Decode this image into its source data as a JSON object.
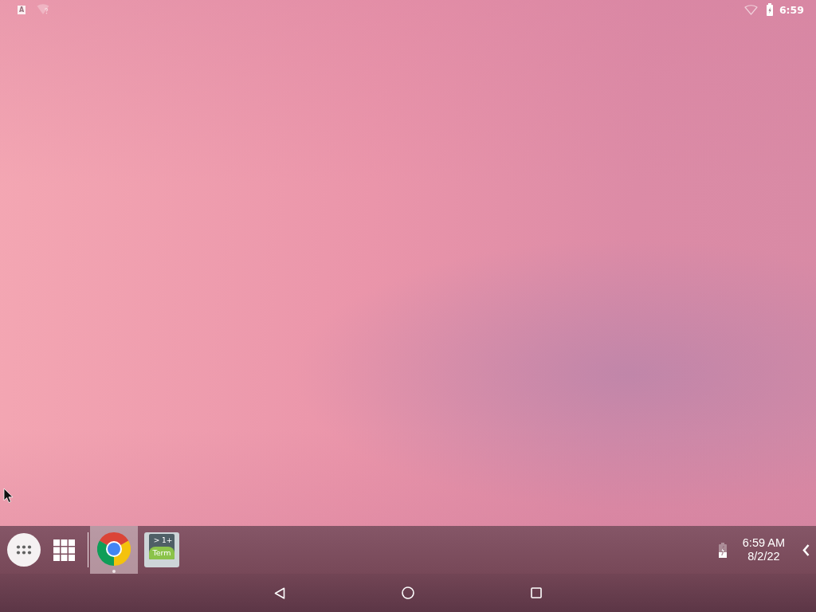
{
  "status_bar": {
    "notifications": [
      {
        "kind": "input_method",
        "text": "A"
      },
      {
        "kind": "wifi_unknown"
      }
    ],
    "wifi": true,
    "battery": {
      "charging": true
    },
    "time": "6:59"
  },
  "taskbar": {
    "launchers": [
      {
        "kind": "app_drawer"
      },
      {
        "kind": "grid"
      }
    ],
    "apps": [
      {
        "kind": "browser",
        "selected": true,
        "running": true
      },
      {
        "kind": "terminal",
        "selected": false,
        "running": false,
        "icon_text": [
          "> 1+",
          "Term"
        ]
      }
    ],
    "tray": {
      "battery": {
        "charging": true
      },
      "time": "6:59 AM",
      "date": "8/2/22"
    }
  },
  "nav_bar": {
    "buttons": [
      {
        "kind": "back"
      },
      {
        "kind": "home"
      },
      {
        "kind": "recents"
      }
    ]
  }
}
